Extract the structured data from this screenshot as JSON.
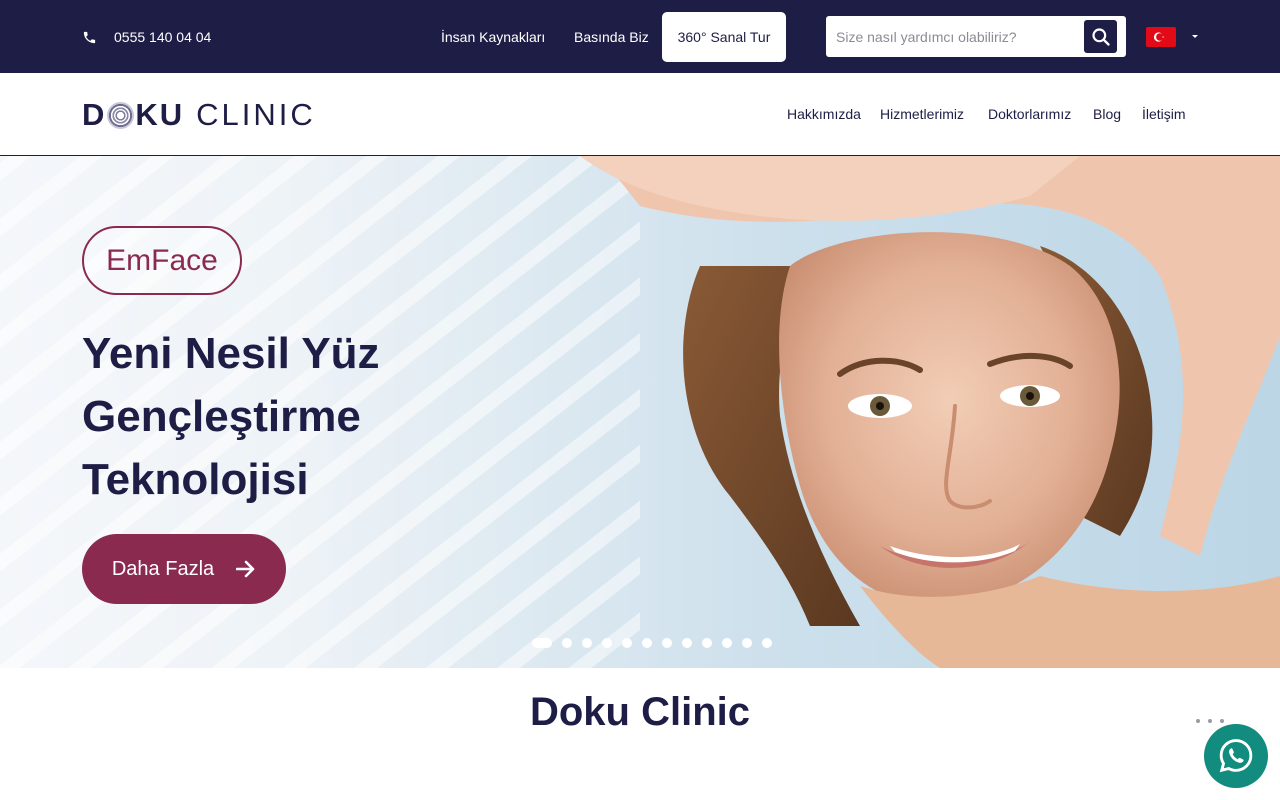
{
  "topbar": {
    "phone": "0555 140 04 04",
    "links": [
      "İnsan Kaynakları",
      "Basında Biz"
    ],
    "tour_button": "360° Sanal Tur",
    "search_placeholder": "Size nasıl yardımcı olabiliriz?",
    "language_flag": "turkey-flag-icon"
  },
  "header": {
    "logo_bold": "D",
    "logo_bold_rest": "KU",
    "logo_thin": "CLINIC",
    "nav": [
      "Hakkımızda",
      "Hizmetlerimiz",
      "Doktorlarımız",
      "Blog",
      "İletişim"
    ]
  },
  "hero": {
    "badge": "EmFace",
    "headline_lines": [
      "Yeni Nesil Yüz",
      "Gençleştirme",
      "Teknolojisi"
    ],
    "cta_label": "Daha Fazla",
    "slide_count": 12,
    "active_slide": 1
  },
  "section": {
    "title": "Doku Clinic"
  },
  "colors": {
    "navy": "#1e1d45",
    "plum": "#8a2a4f",
    "whatsapp": "#118c7e"
  }
}
